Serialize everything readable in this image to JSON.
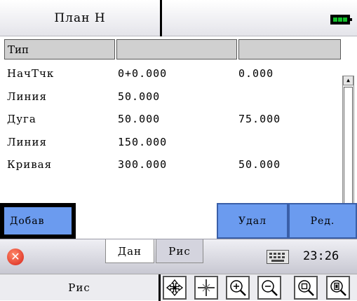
{
  "title": {
    "text": "План Н"
  },
  "grid": {
    "header": "Тип",
    "rows": [
      {
        "name": "НачТчк",
        "v1": "0+0.000",
        "v2": "0.000"
      },
      {
        "name": "Линия",
        "v1": "50.000",
        "v2": ""
      },
      {
        "name": "Дуга",
        "v1": "50.000",
        "v2": "75.000"
      },
      {
        "name": "Линия",
        "v1": "150.000",
        "v2": ""
      },
      {
        "name": "Кривая",
        "v1": "300.000",
        "v2": "50.000"
      }
    ]
  },
  "actions": {
    "add": "Добав",
    "delete": "Удал",
    "edit": "Ред."
  },
  "tabs": {
    "data": "Дан",
    "drawing": "Рис"
  },
  "status": {
    "time": "23:26",
    "battery_color": "#12c02a"
  },
  "toolbar": {
    "label": "Рис",
    "tools": [
      "pan-icon",
      "center-icon",
      "zoom-in-icon",
      "zoom-out-icon",
      "zoom-window-icon",
      "zoom-extents-icon"
    ]
  }
}
